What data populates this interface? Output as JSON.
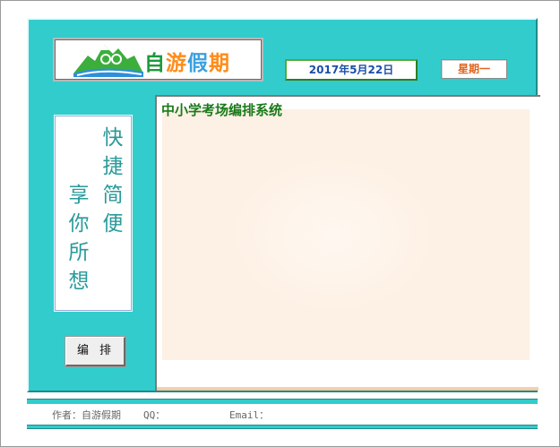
{
  "logo": {
    "chars": [
      "自",
      "游",
      "假",
      "期"
    ],
    "colors": {
      "c1": "#1d9a3a",
      "c2": "#ff8c1a",
      "c3": "#3aa0e0",
      "c4": "#ff8c1a"
    }
  },
  "header": {
    "date": "2017年5月22日",
    "weekday": "星期一"
  },
  "slogan": {
    "column1": [
      "快",
      "捷",
      "简",
      "便"
    ],
    "column2": [
      "享",
      "你",
      "所",
      "想"
    ]
  },
  "main": {
    "title": "中小学考场编排系统"
  },
  "actions": {
    "arrange_label": "编排"
  },
  "footer": {
    "author": "作者：自游假期",
    "qq": "QQ：",
    "email": "Email："
  },
  "colors": {
    "panel": "#33cccc",
    "date_text": "#1b4fa8",
    "weekday_text": "#e0641c",
    "title_text": "#1a7a1a",
    "slogan_text": "#2a9a9a"
  }
}
